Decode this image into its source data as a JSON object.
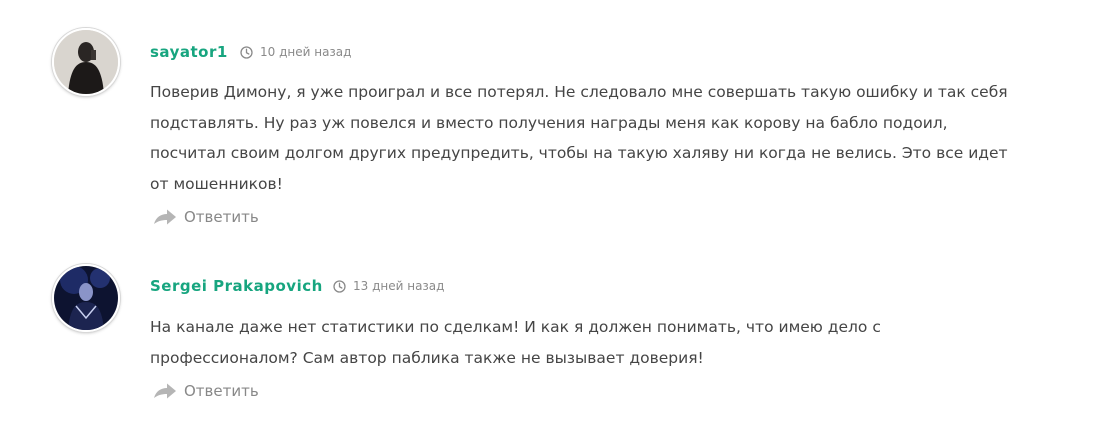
{
  "comments": [
    {
      "author": "sayator1",
      "time": "10 дней назад",
      "text": "Поверив Димону, я уже проиграл и все потерял. Не следовало мне совершать такую ошибку и так себя подставлять. Ну раз уж повелся и вместо получения награды меня как корову на бабло подоил, посчитал своим долгом других предупредить, чтобы на такую халяву ни когда не велись. Это все идет от мошенников!",
      "reply_label": "Ответить"
    },
    {
      "author": "Sergei Prakapovich",
      "time": "13 дней назад",
      "text": "На канале даже нет статистики по сделкам! И как я должен понимать, что имею дело с профессионалом? Сам автор паблика также не вызывает доверия!",
      "reply_label": "Ответить"
    }
  ],
  "colors": {
    "author": "#17a57f",
    "text": "#454545",
    "meta": "#8a8a8a",
    "reply": "#888888"
  },
  "icons": [
    "clock-icon",
    "reply-arrow-icon"
  ]
}
